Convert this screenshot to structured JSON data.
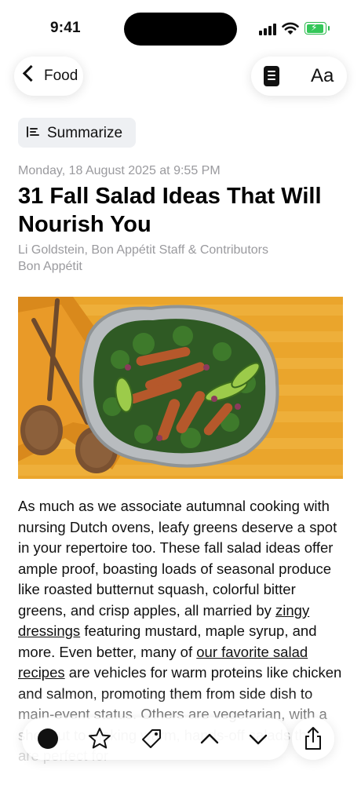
{
  "status": {
    "time": "9:41"
  },
  "nav": {
    "back_label": "Food",
    "font_button": "Aa"
  },
  "summarize_label": "Summarize",
  "article": {
    "date": "Monday, 18 August 2025 at 9:55 PM",
    "title": "31 Fall Salad Ideas That Will Nourish You",
    "authors": "Li Goldstein, Bon Appétit Staff & Contributors",
    "publication": "Bon Appétit",
    "body": {
      "p1": "As much as we associate autumnal cooking with nursing Dutch ovens, leafy greens deserve a spot in your repertoire too. These fall salad ideas offer ample proof, boasting loads of seasonal produce like roasted butternut squash, colorful bitter greens, and crisp apples, all married by ",
      "link1": "zingy dressings",
      "p2": " featuring mustard, maple syrup, and more. Even better, many of ",
      "link2": "our favorite salad recipes",
      "p3": " are vehicles for warm proteins like chicken and salmon, promoting them from side dish to main-event status. Others are vegetarian, with a shortcut to making warm, hands-off salads that are perfect for"
    }
  },
  "toolbar": {
    "icons": [
      "circle-icon",
      "star-icon",
      "tag-icon",
      "chevron-up-icon",
      "chevron-down-icon"
    ],
    "share_icon": "share-icon"
  },
  "colors": {
    "battery": "#34c759",
    "secondary_text": "#9a9a9e",
    "hero_bg": "#e8a22a"
  }
}
